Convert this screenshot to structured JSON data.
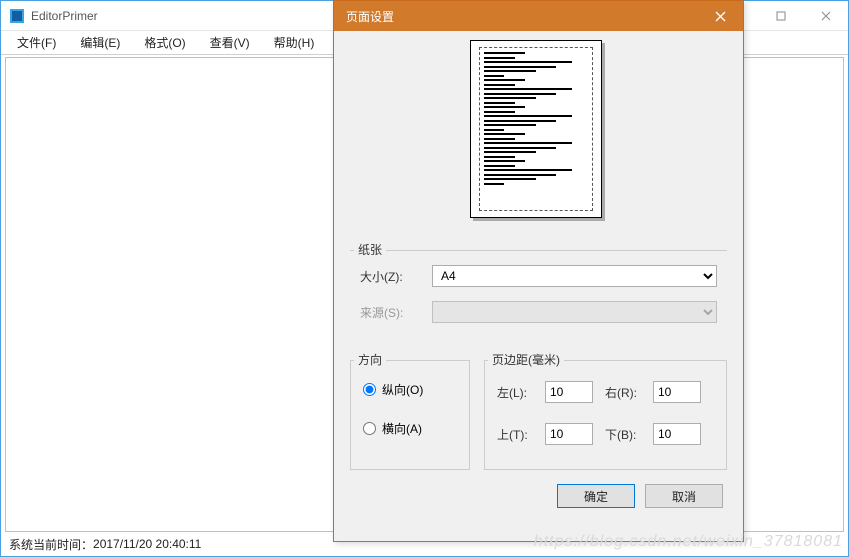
{
  "app": {
    "title": "EditorPrimer",
    "status_prefix": "系统当前时间：",
    "status_time": "2017/11/20 20:40:11"
  },
  "menu": {
    "file": "文件(F)",
    "edit": "编辑(E)",
    "format": "格式(O)",
    "view": "查看(V)",
    "help": "帮助(H)"
  },
  "dialog": {
    "title": "页面设置",
    "paper": {
      "group": "纸张",
      "size_label": "大小(Z):",
      "size_value": "A4",
      "source_label": "来源(S):",
      "source_value": ""
    },
    "orientation": {
      "group": "方向",
      "portrait": "纵向(O)",
      "landscape": "横向(A)",
      "selected": "portrait"
    },
    "margins": {
      "group": "页边距(毫米)",
      "left_label": "左(L):",
      "left_value": "10",
      "right_label": "右(R):",
      "right_value": "10",
      "top_label": "上(T):",
      "top_value": "10",
      "bottom_label": "下(B):",
      "bottom_value": "10"
    },
    "actions": {
      "ok": "确定",
      "cancel": "取消"
    }
  },
  "watermark": "https://blog.csdn.net/weixin_37818081"
}
